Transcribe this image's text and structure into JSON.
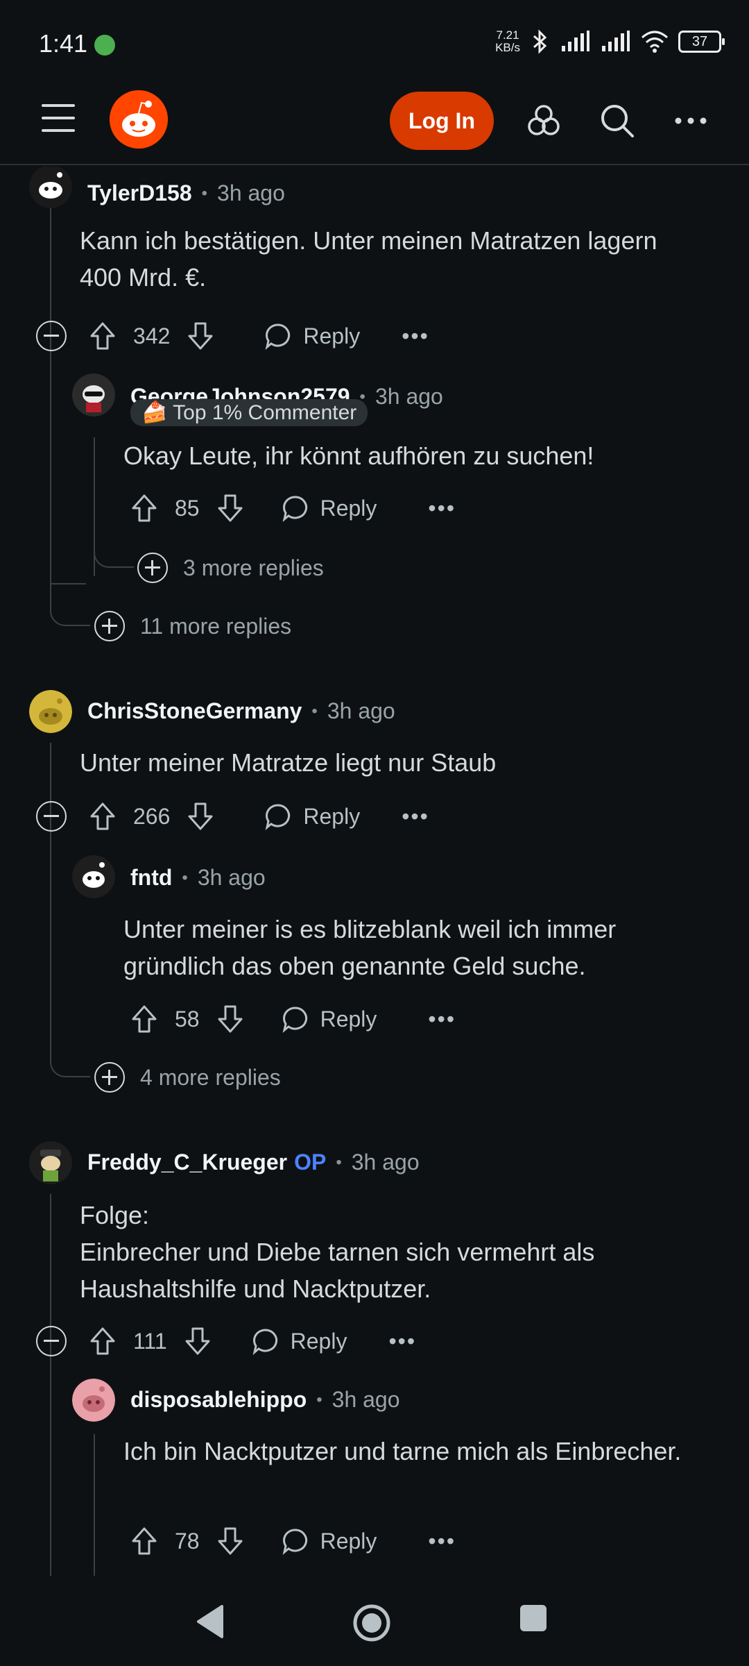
{
  "status": {
    "time": "1:41",
    "net_speed_value": "7.21",
    "net_speed_unit": "KB/s",
    "battery": "37"
  },
  "header": {
    "login_label": "Log In"
  },
  "comments": [
    {
      "author": "TylerD158",
      "time": "3h ago",
      "body": "Kann ich bestätigen. Unter meinen Matratzen lagern 400 Mrd. €.",
      "score": "342",
      "reply_label": "Reply",
      "replies": [
        {
          "author": "GeorgeJohnson2579",
          "time": "3h ago",
          "flair": "Top 1% Commenter",
          "body": "Okay Leute, ihr könnt aufhören zu suchen!",
          "score": "85",
          "reply_label": "Reply",
          "more_replies": "3 more replies"
        }
      ],
      "more_replies": "11 more replies"
    },
    {
      "author": "ChrisStoneGermany",
      "time": "3h ago",
      "body": "Unter meiner Matratze liegt nur Staub",
      "score": "266",
      "reply_label": "Reply",
      "replies": [
        {
          "author": "fntd",
          "time": "3h ago",
          "body": "Unter meiner is es blitzeblank weil ich immer gründlich das oben genannte Geld suche.",
          "score": "58",
          "reply_label": "Reply"
        }
      ],
      "more_replies": "4 more replies"
    },
    {
      "author": "Freddy_C_Krueger",
      "op_badge": "OP",
      "time": "3h ago",
      "body": "Folge:\nEinbrecher und Diebe tarnen sich vermehrt als Haushaltshilfe und Nacktputzer.",
      "score": "111",
      "reply_label": "Reply",
      "replies": [
        {
          "author": "disposablehippo",
          "time": "3h ago",
          "body": "Ich bin Nacktputzer und tarne mich als Einbrecher.",
          "score": "78",
          "reply_label": "Reply"
        }
      ]
    }
  ],
  "colors": {
    "background": "#0e1113",
    "brand": "#ff4500",
    "login": "#d93a00",
    "op": "#4c83ff"
  }
}
